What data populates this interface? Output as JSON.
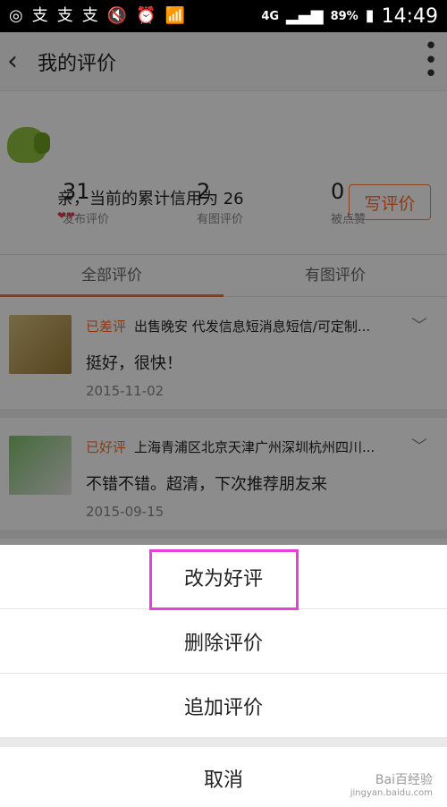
{
  "statusbar": {
    "left_icons": [
      "weibo-icon",
      "glyph-icon",
      "glyph-icon",
      "glyph-icon",
      "mute-icon",
      "alarm-icon",
      "wifi-icon"
    ],
    "network": "4G",
    "battery": "89%",
    "time": "14:49"
  },
  "header": {
    "title": "我的评价"
  },
  "profile": {
    "greeting": "亲，当前的累计信用为 26",
    "hearts": "❤❤",
    "write_label": "写评价",
    "stats": [
      {
        "num": "31",
        "label": "发布评价"
      },
      {
        "num": "2",
        "label": "有图评价"
      },
      {
        "num": "0",
        "label": "被点赞"
      }
    ]
  },
  "tabs": [
    {
      "label": "全部评价",
      "active": true
    },
    {
      "label": "有图评价",
      "active": false
    }
  ],
  "reviews": [
    {
      "tag": "已差评",
      "product": "出售晚安 代发信息短消息短信/可定制...",
      "comment": "挺好，很快！",
      "date": "2015-11-02"
    },
    {
      "tag": "已好评",
      "product": "上海青浦区北京天津广州深圳杭州四川...",
      "comment": "不错不错。超清，下次推荐朋友来",
      "date": "2015-09-15"
    }
  ],
  "sheet": {
    "options": [
      {
        "label": "改为好评",
        "highlighted": true
      },
      {
        "label": "删除评价",
        "highlighted": false
      },
      {
        "label": "追加评价",
        "highlighted": false
      }
    ],
    "cancel": "取消"
  },
  "watermark": {
    "line1": "Bai百经验",
    "line2": "jingyan.baidu.com"
  },
  "colors": {
    "accent": "#ff6a2a",
    "highlight": "#e640d9"
  }
}
